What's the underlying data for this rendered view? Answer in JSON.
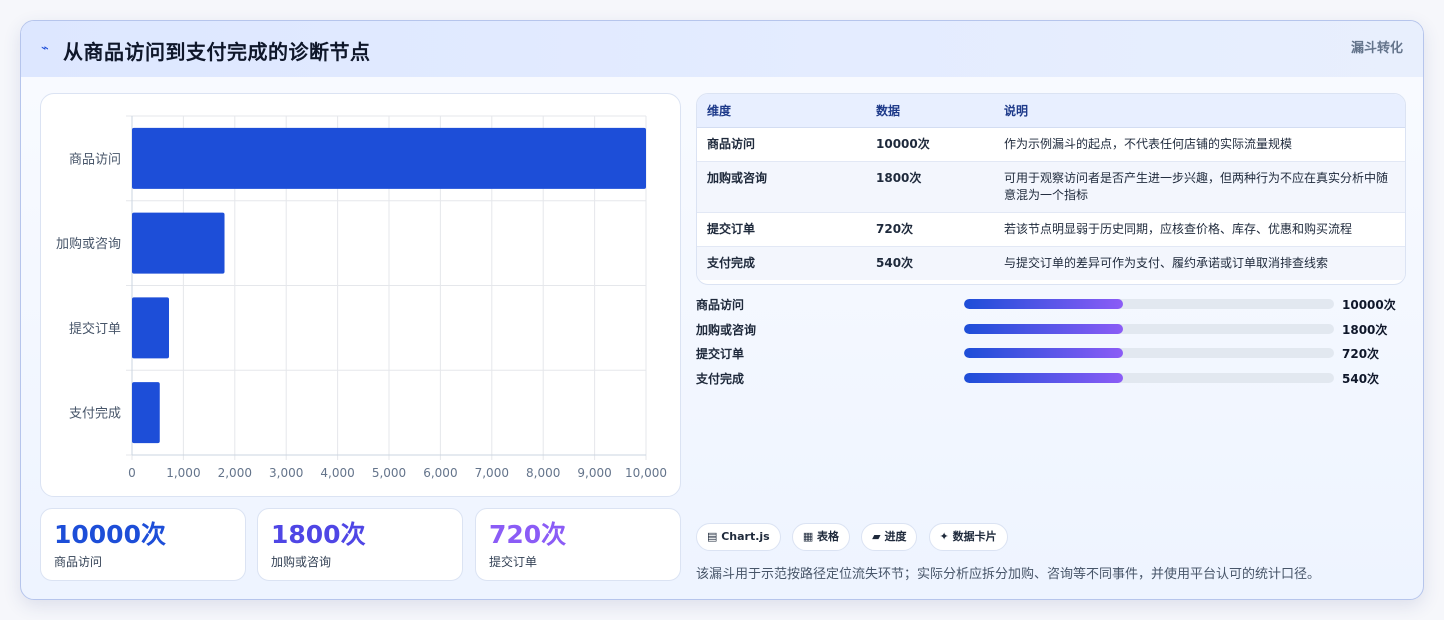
{
  "header": {
    "icon": "pulse-icon",
    "title": "从商品访问到支付完成的诊断节点",
    "tag": "漏斗转化"
  },
  "chart_data": {
    "type": "bar",
    "orientation": "horizontal",
    "categories": [
      "商品访问",
      "加购或咨询",
      "提交订单",
      "支付完成"
    ],
    "values": [
      10000,
      1800,
      720,
      540
    ],
    "xlim": [
      0,
      10000
    ],
    "xticks": [
      "0",
      "1,000",
      "2,000",
      "3,000",
      "4,000",
      "5,000",
      "6,000",
      "7,000",
      "8,000",
      "9,000",
      "10,000"
    ],
    "bar_color": "#1d4ed8",
    "grid": true,
    "legend": "none"
  },
  "stats": [
    {
      "value": "10000次",
      "label": "商品访问",
      "color": "#1d4ed8"
    },
    {
      "value": "1800次",
      "label": "加购或咨询",
      "color": "#4f46e5"
    },
    {
      "value": "720次",
      "label": "提交订单",
      "color": "#8b5cf6"
    }
  ],
  "table": {
    "headers": [
      "维度",
      "数据",
      "说明"
    ],
    "rows": [
      [
        "商品访问",
        "10000次",
        "作为示例漏斗的起点，不代表任何店铺的实际流量规模"
      ],
      [
        "加购或咨询",
        "1800次",
        "可用于观察访问者是否产生进一步兴趣，但两种行为不应在真实分析中随意混为一个指标"
      ],
      [
        "提交订单",
        "720次",
        "若该节点明显弱于历史同期，应核查价格、库存、优惠和购买流程"
      ],
      [
        "支付完成",
        "540次",
        "与提交订单的差异可作为支付、履约承诺或订单取消排查线索"
      ]
    ]
  },
  "progress": [
    {
      "label": "商品访问",
      "value": "10000次",
      "fraction": 0.43
    },
    {
      "label": "加购或咨询",
      "value": "1800次",
      "fraction": 0.43
    },
    {
      "label": "提交订单",
      "value": "720次",
      "fraction": 0.43
    },
    {
      "label": "支付完成",
      "value": "540次",
      "fraction": 0.43
    }
  ],
  "chips": [
    {
      "icon": "chart-icon",
      "label": "▤ Chart.js"
    },
    {
      "icon": "table-icon",
      "label": "▦ 表格"
    },
    {
      "icon": "progress-icon",
      "label": "▰ 进度"
    },
    {
      "icon": "sparkle-icon",
      "label": "✦ 数据卡片"
    }
  ],
  "footnote": "该漏斗用于示范按路径定位流失环节；实际分析应拆分加购、咨询等不同事件，并使用平台认可的统计口径。"
}
